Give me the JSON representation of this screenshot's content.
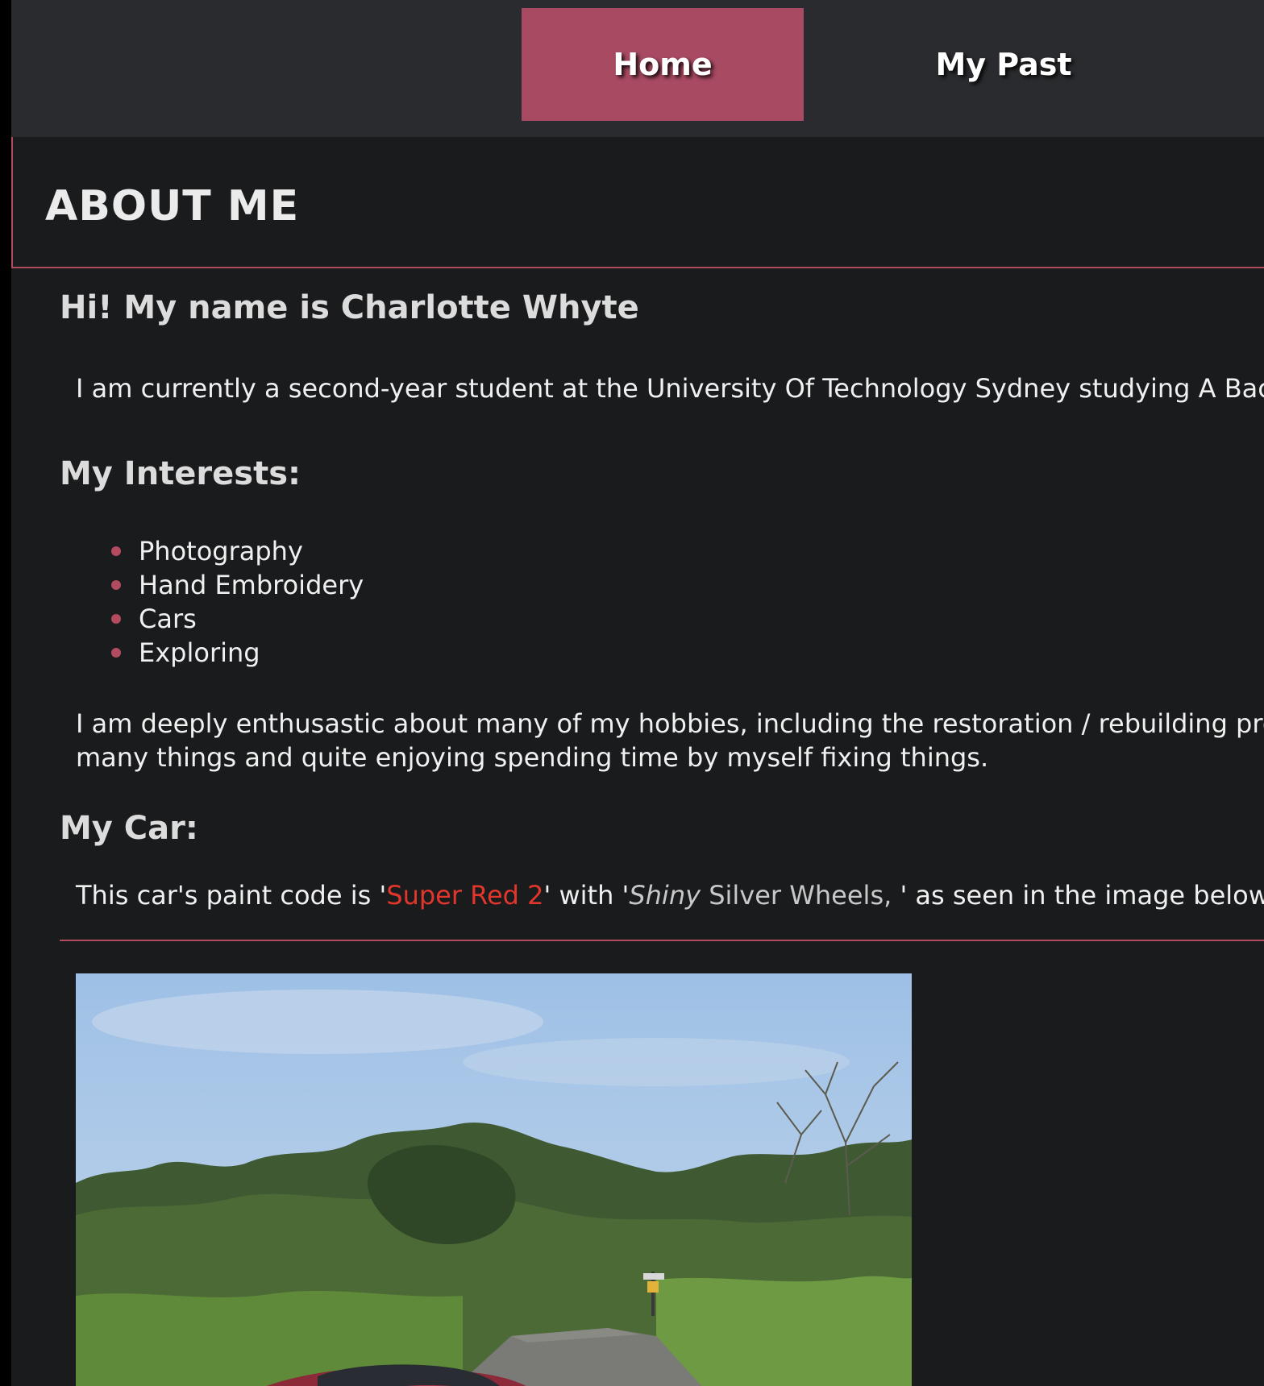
{
  "nav": {
    "items": [
      {
        "label": "Home",
        "active": true
      },
      {
        "label": "My Past",
        "active": false
      }
    ]
  },
  "header": {
    "title": "ABOUT ME"
  },
  "intro": {
    "heading": "Hi! My name is Charlotte Whyte",
    "text": "I am currently a second-year student at the University Of Technology Sydney studying A Bache"
  },
  "interests": {
    "heading": "My Interests:",
    "items": [
      "Photography",
      "Hand Embroidery",
      "Cars",
      "Exploring"
    ]
  },
  "hobbies": {
    "line1": "I am deeply enthusastic about many of my hobbies, including the restoration / rebuilding progr",
    "line2": "many things and quite enjoying spending time by myself fixing things."
  },
  "car": {
    "heading": "My Car:",
    "text_before": "This car's paint code is '",
    "paint_code": "Super Red 2",
    "text_middle": "' with '",
    "wheels_italic": "Shiny",
    "wheels_rest": " Silver Wheels, ",
    "text_after": "' as seen in the image below."
  },
  "colors": {
    "accent": "#a84a62",
    "nav_bg": "#2a2b2e",
    "page_bg": "#1a1b1d",
    "paint_code": "#e2362c"
  }
}
